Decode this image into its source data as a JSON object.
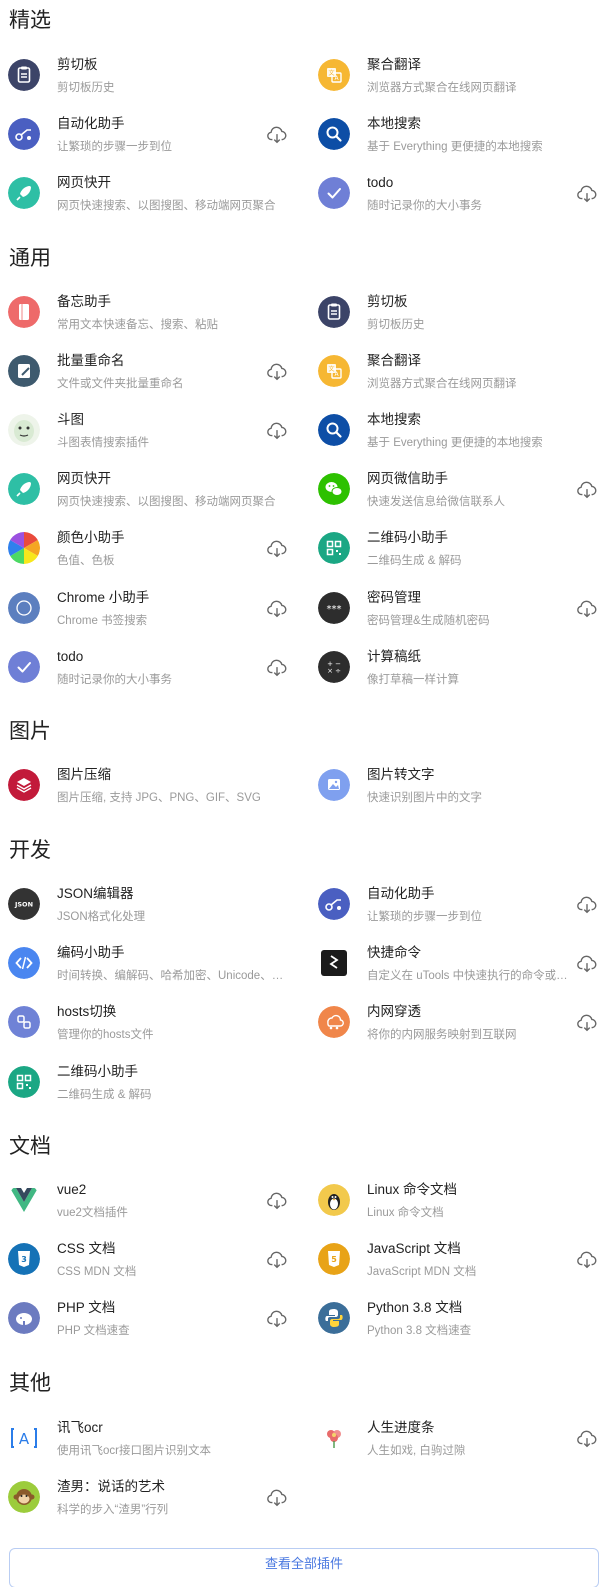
{
  "sections": {
    "featured": {
      "title": "精选",
      "items": [
        {
          "name": "剪切板",
          "desc": "剪切板历史",
          "icon": "clipboard-icon",
          "color": "#3c4468"
        },
        {
          "name": "聚合翻译",
          "desc": "浏览器方式聚合在线网页翻译",
          "icon": "translate-icon",
          "color": "#f6b733"
        },
        {
          "name": "自动化助手",
          "desc": "让繁琐的步骤一步到位",
          "icon": "automation-icon",
          "color": "#4a5fc1"
        },
        {
          "name": "本地搜索",
          "desc": "基于 Everything 更便捷的本地搜索",
          "icon": "magnifier-icon",
          "color": "#0d4ea6"
        },
        {
          "name": "网页快开",
          "desc": "网页快速搜索、以图搜图、移动端网页聚合",
          "icon": "rocket-icon",
          "color": "#2ebfa5"
        },
        {
          "name": "todo",
          "desc": "随时记录你的大小事务",
          "icon": "check-icon",
          "color": "#6f7fd6"
        }
      ]
    },
    "general": {
      "title": "通用",
      "items": [
        {
          "name": "备忘助手",
          "desc": "常用文本快速备忘、搜索、粘贴",
          "icon": "notebook-icon",
          "color": "#ee6a6a"
        },
        {
          "name": "剪切板",
          "desc": "剪切板历史",
          "icon": "clipboard-icon",
          "color": "#3c4468"
        },
        {
          "name": "批量重命名",
          "desc": "文件或文件夹批量重命名",
          "icon": "rename-icon",
          "color": "#3e5a6e"
        },
        {
          "name": "聚合翻译",
          "desc": "浏览器方式聚合在线网页翻译",
          "icon": "translate-icon",
          "color": "#f6b733"
        },
        {
          "name": "斗图",
          "desc": "斗图表情搜索插件",
          "icon": "meme-face-icon",
          "color": "#d9ead3"
        },
        {
          "name": "本地搜索",
          "desc": "基于 Everything 更便捷的本地搜索",
          "icon": "magnifier-icon",
          "color": "#0d4ea6"
        },
        {
          "name": "网页快开",
          "desc": "网页快速搜索、以图搜图、移动端网页聚合",
          "icon": "rocket-icon",
          "color": "#2ebfa5"
        },
        {
          "name": "网页微信助手",
          "desc": "快速发送信息给微信联系人",
          "icon": "wechat-icon",
          "color": "#2dc100"
        },
        {
          "name": "颜色小助手",
          "desc": "色值、色板",
          "icon": "color-wheel-icon",
          "color": "#e94a3c"
        },
        {
          "name": "二维码小助手",
          "desc": "二维码生成 & 解码",
          "icon": "qrcode-icon",
          "color": "#1ba784"
        },
        {
          "name": "Chrome 小助手",
          "desc": "Chrome 书签搜索",
          "icon": "chrome-icon",
          "color": "#5c7fbf"
        },
        {
          "name": "密码管理",
          "desc": "密码管理&生成随机密码",
          "icon": "password-icon",
          "color": "#2d2d2d"
        },
        {
          "name": "todo",
          "desc": "随时记录你的大小事务",
          "icon": "check-icon",
          "color": "#6f7fd6"
        },
        {
          "name": "计算稿纸",
          "desc": "像打草稿一样计算",
          "icon": "calculator-icon",
          "color": "#2d2d2d"
        }
      ]
    },
    "images": {
      "title": "图片",
      "items": [
        {
          "name": "图片压缩",
          "desc": "图片压缩, 支持 JPG、PNG、GIF、SVG",
          "icon": "layers-icon",
          "color": "#c21a3a"
        },
        {
          "name": "图片转文字",
          "desc": "快速识别图片中的文字",
          "icon": "image-text-icon",
          "color": "#7fa0ef"
        }
      ]
    },
    "dev": {
      "title": "开发",
      "items": [
        {
          "name": "JSON编辑器",
          "desc": "JSON格式化处理",
          "icon": "json-icon",
          "color": "#333333"
        },
        {
          "name": "自动化助手",
          "desc": "让繁琐的步骤一步到位",
          "icon": "automation-icon",
          "color": "#4a5fc1"
        },
        {
          "name": "编码小助手",
          "desc": "时间转换、编解码、哈希加密、Unicode、…",
          "icon": "code-icon",
          "color": "#4a86f0"
        },
        {
          "name": "快捷命令",
          "desc": "自定义在 uTools 中快速执行的命令或…",
          "icon": "command-icon",
          "color": "#1b1b1b"
        },
        {
          "name": "hosts切换",
          "desc": "管理你的hosts文件",
          "icon": "hosts-icon",
          "color": "#6f82d6"
        },
        {
          "name": "内网穿透",
          "desc": "将你的内网服务映射到互联网",
          "icon": "tunnel-icon",
          "color": "#f0864a"
        },
        {
          "name": "二维码小助手",
          "desc": "二维码生成 & 解码",
          "icon": "qrcode-icon",
          "color": "#1ba784"
        }
      ]
    },
    "docs": {
      "title": "文档",
      "items": [
        {
          "name": "vue2",
          "desc": "vue2文档插件",
          "icon": "vue-icon",
          "color": "#41b883"
        },
        {
          "name": "Linux 命令文档",
          "desc": "Linux 命令文档",
          "icon": "penguin-icon",
          "color": "#f2c94c"
        },
        {
          "name": "CSS 文档",
          "desc": "CSS MDN 文档",
          "icon": "css-icon",
          "color": "#1572b6"
        },
        {
          "name": "JavaScript 文档",
          "desc": "JavaScript MDN 文档",
          "icon": "js-icon",
          "color": "#e8a317"
        },
        {
          "name": "PHP 文档",
          "desc": "PHP 文档速查",
          "icon": "php-icon",
          "color": "#6c7bc0"
        },
        {
          "name": "Python 3.8 文档",
          "desc": "Python 3.8 文档速查",
          "icon": "python-icon",
          "color": "#3b6e99"
        }
      ]
    },
    "other": {
      "title": "其他",
      "items": [
        {
          "name": "讯飞ocr",
          "desc": "使用讯飞ocr接口图片识别文本",
          "icon": "ocr-icon",
          "color": "#2b7de9"
        },
        {
          "name": "人生进度条",
          "desc": "人生如戏, 白驹过隙",
          "icon": "flower-icon",
          "color": "#e86b6b"
        },
        {
          "name": "渣男：说话的艺术",
          "desc": "科学的步入“渣男”行列",
          "icon": "monkey-icon",
          "color": "#9ccc3c"
        }
      ]
    }
  },
  "footer": {
    "view_all_label": "查看全部插件"
  }
}
